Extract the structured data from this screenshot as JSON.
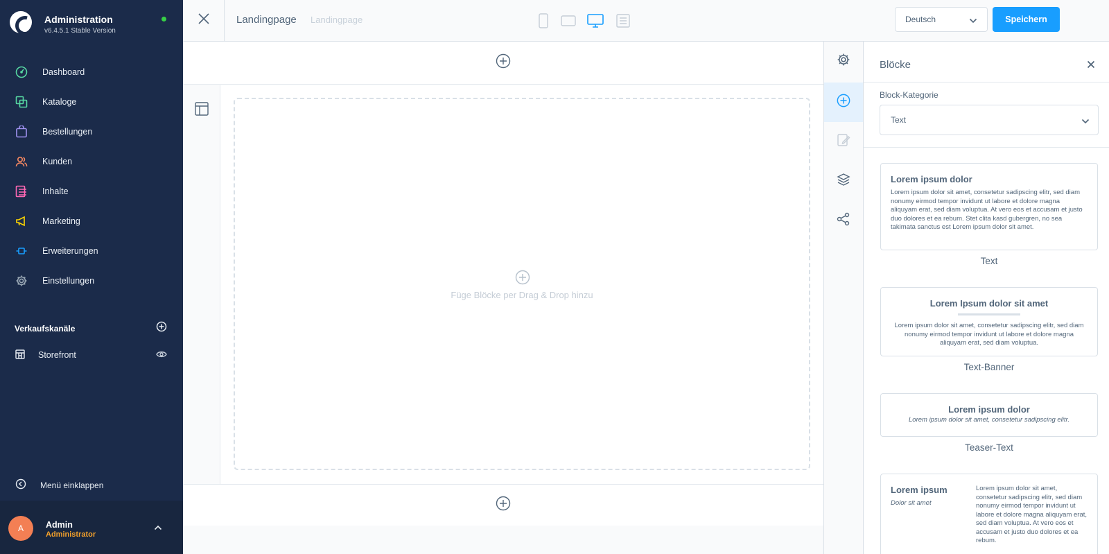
{
  "brand": {
    "title": "Administration",
    "version": "v6.4.5.1 Stable Version"
  },
  "nav": {
    "dashboard": "Dashboard",
    "catalogues": "Kataloge",
    "orders": "Bestellungen",
    "customers": "Kunden",
    "content": "Inhalte",
    "marketing": "Marketing",
    "extensions": "Erweiterungen",
    "settings": "Einstellungen"
  },
  "nav_icon_colors": {
    "dashboard": "#57d9a3",
    "catalogues": "#57d9a3",
    "orders": "#a092f0",
    "customers": "#f88962",
    "content": "#ff68b4",
    "marketing": "#ffd700",
    "extensions": "#189eff",
    "settings": "#9aa8b5"
  },
  "sales_channels": {
    "title": "Verkaufskanäle",
    "storefront": "Storefront"
  },
  "collapse_menu": "Menü einklappen",
  "user": {
    "initial": "A",
    "name": "Admin",
    "role": "Administrator"
  },
  "topbar": {
    "page_title": "Landingpage",
    "page_subtitle": "Landingpage",
    "language": "Deutsch",
    "save": "Speichern"
  },
  "canvas": {
    "dropzone_hint": "Füge Blöcke per Drag & Drop hinzu"
  },
  "panel": {
    "title": "Blöcke",
    "category_label": "Block-Kategorie",
    "category_value": "Text",
    "blocks": [
      {
        "heading": "Lorem ipsum dolor",
        "body": "Lorem ipsum dolor sit amet, consetetur sadipscing elitr, sed diam nonumy eirmod tempor invidunt ut labore et dolore magna aliquyam erat, sed diam voluptua. At vero eos et accusam et justo duo dolores et ea rebum. Stet clita kasd gubergren, no sea takimata sanctus est Lorem ipsum dolor sit amet.",
        "label": "Text"
      },
      {
        "heading": "Lorem Ipsum dolor sit amet",
        "body": "Lorem ipsum dolor sit amet, consetetur sadipscing elitr, sed diam nonumy eirmod tempor invidunt ut labore et dolore magna aliquyam erat, sed diam voluptua.",
        "label": "Text-Banner"
      },
      {
        "heading": "Lorem ipsum dolor",
        "body": "Lorem ipsum dolor sit amet, consetetur sadipscing elitr.",
        "label": "Teaser-Text"
      },
      {
        "heading": "Lorem ipsum",
        "sub": "Dolor sit amet",
        "body": "Lorem ipsum dolor sit amet, consetetur sadipscing elitr, sed diam nonumy eirmod tempor invidunt ut labore et dolore magna aliquyam erat, sed diam voluptua. At vero eos et accusam et justo duo dolores et ea rebum."
      }
    ]
  },
  "colors": {
    "sidebar": "#1b2b4a",
    "accent": "#189eff",
    "status_online": "#37d046",
    "avatar": "#f37f54",
    "role": "#f4a12b"
  }
}
